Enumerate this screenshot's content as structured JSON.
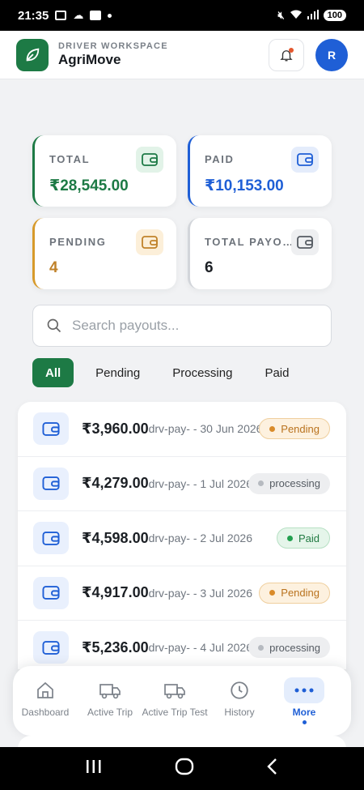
{
  "status_bar": {
    "time": "21:35",
    "battery": "100"
  },
  "header": {
    "subtitle": "DRIVER WORKSPACE",
    "title": "AgriMove",
    "avatar_initial": "R"
  },
  "stats": [
    {
      "label": "TOTAL",
      "value": "₹28,545.00",
      "color": "#1d7a45"
    },
    {
      "label": "PAID",
      "value": "₹10,153.00",
      "color": "#1f5fd6"
    },
    {
      "label": "PENDING",
      "value": "4",
      "color": "#c0822a"
    },
    {
      "label": "TOTAL PAYOUTS",
      "value": "6",
      "color": "#1b1f24"
    }
  ],
  "search": {
    "placeholder": "Search payouts..."
  },
  "filters": [
    "All",
    "Pending",
    "Processing",
    "Paid"
  ],
  "payouts": [
    {
      "amount": "₹3,960.00",
      "meta": "drv-pay- - 30 Jun 2026",
      "status": "Pending"
    },
    {
      "amount": "₹4,279.00",
      "meta": "drv-pay- - 1 Jul 2026",
      "status": "processing"
    },
    {
      "amount": "₹4,598.00",
      "meta": "drv-pay- - 2 Jul 2026",
      "status": "Paid"
    },
    {
      "amount": "₹4,917.00",
      "meta": "drv-pay- - 3 Jul 2026",
      "status": "Pending"
    },
    {
      "amount": "₹5,236.00",
      "meta": "drv-pay- - 4 Jul 2026",
      "status": "processing"
    }
  ],
  "nav": [
    {
      "label": "Dashboard",
      "icon": "home-icon"
    },
    {
      "label": "Active Trip",
      "icon": "truck-icon"
    },
    {
      "label": "Active Trip Test",
      "icon": "truck-icon"
    },
    {
      "label": "History",
      "icon": "clock-icon"
    },
    {
      "label": "More",
      "icon": "more-icon",
      "active": true
    }
  ]
}
